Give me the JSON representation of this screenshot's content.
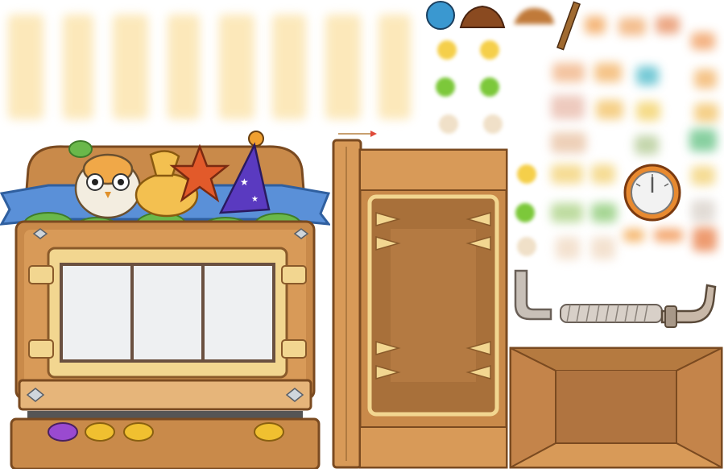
{
  "sheet": {
    "kind": "sprite-atlas",
    "sprites": [
      "glow-strip-column",
      "slot-machine-cabinet",
      "reel-window",
      "topper-owl",
      "topper-coin-bag",
      "topper-star",
      "topper-wizard-hat",
      "ribbon-banner",
      "button-purple",
      "button-yellow",
      "button-yellow",
      "button-yellow",
      "cabinet-side-panel",
      "tooth-frame-box",
      "pressure-gauge",
      "pipe-elbow",
      "threaded-rod",
      "hook-pipe",
      "open-crate",
      "blue-ball",
      "wooden-lid",
      "brown-cap",
      "stick",
      "bee-icon",
      "green-bird-icon",
      "chick-icon",
      "dart-arrow"
    ]
  },
  "colors": {
    "wood": "#c98a4a",
    "wood_dark": "#8a5428",
    "wood_light": "#e6b57a",
    "gold": "#f2d690",
    "ribbon": "#5a90d8",
    "leaf": "#6ab84a",
    "glow": "#fbe3a8"
  }
}
